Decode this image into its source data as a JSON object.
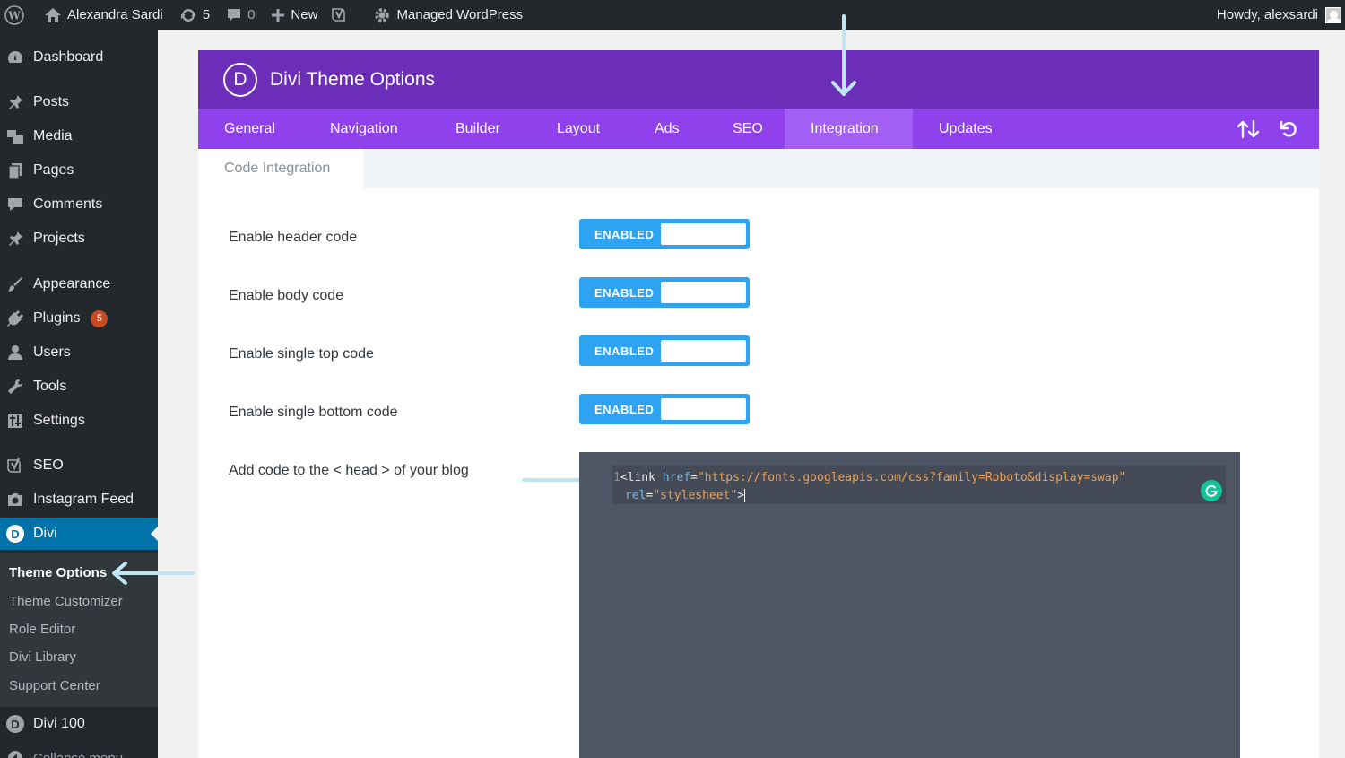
{
  "admin_bar": {
    "site_name": "Alexandra Sardi",
    "updates_count": "5",
    "comments_count": "0",
    "new_label": "New",
    "hosting_label": "Managed WordPress",
    "greeting": "Howdy, alexsardi"
  },
  "sidebar": {
    "items": [
      {
        "label": "Dashboard",
        "icon": "dashboard-icon"
      },
      {
        "label": "Posts",
        "icon": "pin-icon"
      },
      {
        "label": "Media",
        "icon": "media-icon"
      },
      {
        "label": "Pages",
        "icon": "pages-icon"
      },
      {
        "label": "Comments",
        "icon": "comment-icon"
      },
      {
        "label": "Projects",
        "icon": "pin-icon"
      },
      {
        "label": "Appearance",
        "icon": "brush-icon"
      },
      {
        "label": "Plugins",
        "icon": "plug-icon",
        "badge": "5"
      },
      {
        "label": "Users",
        "icon": "user-icon"
      },
      {
        "label": "Tools",
        "icon": "wrench-icon"
      },
      {
        "label": "Settings",
        "icon": "settings-icon"
      },
      {
        "label": "SEO",
        "icon": "yoast-icon"
      },
      {
        "label": "Instagram Feed",
        "icon": "camera-icon"
      },
      {
        "label": "Divi",
        "icon": "divi-icon"
      },
      {
        "label": "Divi 100",
        "icon": "divi-icon"
      },
      {
        "label": "Collapse menu",
        "icon": "collapse-icon"
      }
    ],
    "submenu": [
      "Theme Options",
      "Theme Customizer",
      "Role Editor",
      "Divi Library",
      "Support Center"
    ]
  },
  "panel": {
    "logo_letter": "D",
    "title": "Divi Theme Options",
    "tabs": [
      "General",
      "Navigation",
      "Builder",
      "Layout",
      "Ads",
      "SEO",
      "Integration",
      "Updates"
    ],
    "active_tab": "Integration",
    "subtab": "Code Integration",
    "options": [
      {
        "label": "Enable header code",
        "state": "ENABLED"
      },
      {
        "label": "Enable body code",
        "state": "ENABLED"
      },
      {
        "label": "Enable single top code",
        "state": "ENABLED"
      },
      {
        "label": "Enable single bottom code",
        "state": "ENABLED"
      }
    ],
    "code_label": "Add code to the < head > of your blog",
    "code": {
      "line_number": "1",
      "tag_open": "<link",
      "attr_href": "href",
      "eq": "=",
      "href_value": "\"https://fonts.googleapis.com/css?family=Roboto&display=swap\"",
      "attr_rel": "rel",
      "rel_value": "\"stylesheet\"",
      "tag_close": ">"
    }
  },
  "colors": {
    "wp_dark": "#23282d",
    "wp_blue": "#0073aa",
    "divi_purple_dark": "#6c2eb9",
    "divi_purple": "#8f42ec",
    "toggle_blue": "#2ea3f2",
    "annotation_arrow": "#bfe6f5"
  }
}
